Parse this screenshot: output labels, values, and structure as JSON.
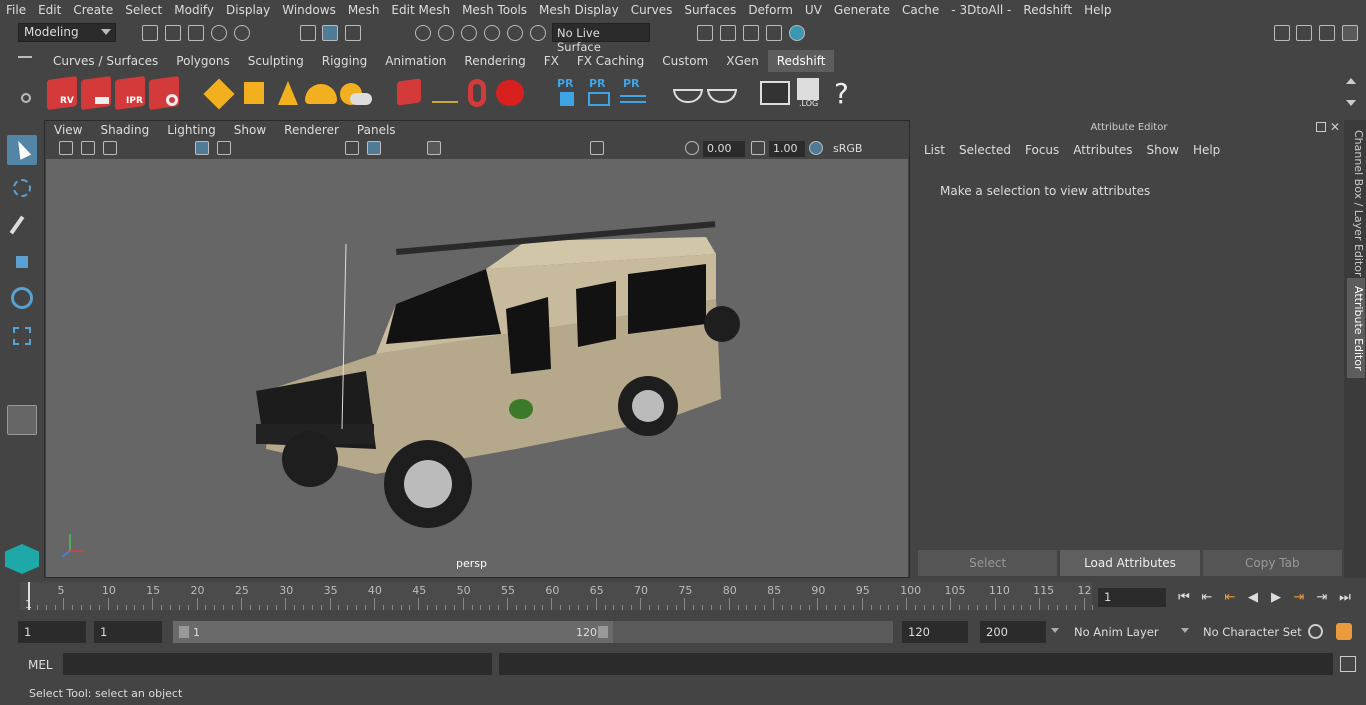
{
  "menu": [
    "File",
    "Edit",
    "Create",
    "Select",
    "Modify",
    "Display",
    "Windows",
    "Mesh",
    "Edit Mesh",
    "Mesh Tools",
    "Mesh Display",
    "Curves",
    "Surfaces",
    "Deform",
    "UV",
    "Generate",
    "Cache",
    "- 3DtoAll -",
    "Redshift",
    "Help"
  ],
  "mode": "Modeling",
  "live_surface": "No Live Surface",
  "shelf_tabs": [
    "Curves / Surfaces",
    "Polygons",
    "Sculpting",
    "Rigging",
    "Animation",
    "Rendering",
    "FX",
    "FX Caching",
    "Custom",
    "XGen",
    "Redshift"
  ],
  "active_shelf": "Redshift",
  "shelf_labels": {
    "rv": "RV",
    "ipr": "IPR",
    "pr": "PR",
    "log": ".LOG",
    "help": "?"
  },
  "viewport": {
    "menu": [
      "View",
      "Shading",
      "Lighting",
      "Show",
      "Renderer",
      "Panels"
    ],
    "exposure": "0.00",
    "gamma": "1.00",
    "colorspace": "sRGB gamma",
    "camera": "persp"
  },
  "attribute_editor": {
    "title": "Attribute Editor",
    "menu": [
      "List",
      "Selected",
      "Focus",
      "Attributes",
      "Show",
      "Help"
    ],
    "message": "Make a selection to view attributes",
    "buttons": [
      "Select",
      "Load Attributes",
      "Copy Tab"
    ]
  },
  "side_tabs": [
    "Channel Box / Layer Editor",
    "Attribute Editor"
  ],
  "timeline": {
    "ticks": [
      "5",
      "10",
      "15",
      "20",
      "25",
      "30",
      "35",
      "40",
      "45",
      "50",
      "55",
      "60",
      "65",
      "70",
      "75",
      "80",
      "85",
      "90",
      "95",
      "100",
      "105",
      "110",
      "115",
      "12"
    ],
    "start_label": "1",
    "current_frame": "1"
  },
  "range": {
    "start": "1",
    "playback_start": "1",
    "slider_start": "1",
    "slider_end": "120",
    "playback_end": "120",
    "end": "200",
    "anim_layer": "No Anim Layer",
    "char_set": "No Character Set"
  },
  "command_line": {
    "label": "MEL"
  },
  "status_text": "Select Tool: select an object"
}
